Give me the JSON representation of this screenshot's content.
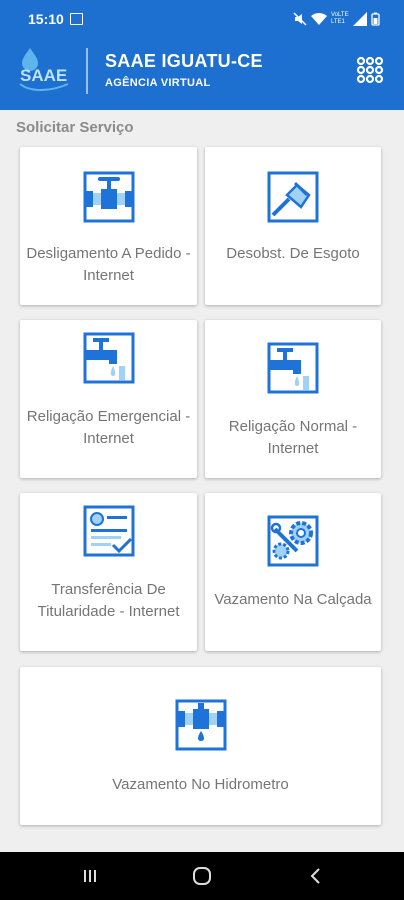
{
  "status": {
    "time": "15:10",
    "net_label": "VoLTE LTE1"
  },
  "header": {
    "title": "SAAE IGUATU-CE",
    "subtitle": "AGÊNCIA VIRTUAL",
    "logo_text": "SAAE"
  },
  "section": {
    "title": "Solicitar Serviço"
  },
  "services": [
    {
      "label": "Desligamento A Pedido - Internet",
      "icon": "valve-pipe-icon"
    },
    {
      "label": "Desobst. De Esgoto",
      "icon": "plunger-icon"
    },
    {
      "label": "Religação Emergencial - Internet",
      "icon": "faucet-icon"
    },
    {
      "label": "Religação Normal - Internet",
      "icon": "faucet-icon"
    },
    {
      "label": "Transferência De Titularidade - Internet",
      "icon": "document-check-icon"
    },
    {
      "label": "Vazamento Na Calçada",
      "icon": "gear-wrench-icon"
    },
    {
      "label": "Vazamento No Hidrometro",
      "icon": "pipe-leak-icon"
    }
  ],
  "colors": {
    "primary": "#1d6fd0",
    "icon_blue": "#1f73d8",
    "icon_light": "#9fd2f5",
    "text": "#757575",
    "background": "#efefef"
  }
}
